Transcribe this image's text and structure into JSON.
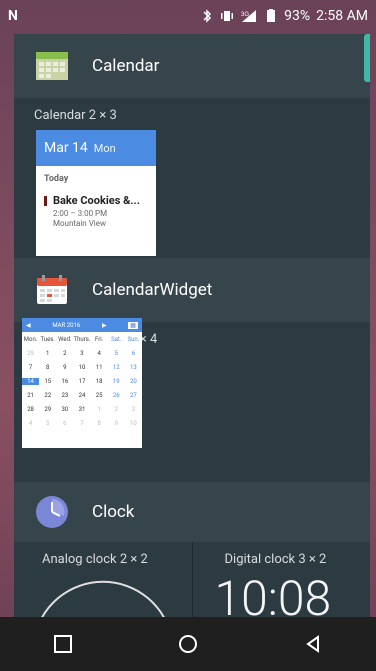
{
  "statusbar": {
    "battery": "93%",
    "time": "2:58 AM",
    "network": "3G"
  },
  "sections": [
    {
      "app_name": "Calendar",
      "widget_label": "Calendar  2 × 3"
    },
    {
      "app_name": "CalendarWidget",
      "widget_label": "CalendarWidget  4 × 4"
    },
    {
      "app_name": "Clock"
    }
  ],
  "calendar_preview": {
    "date": "Mar 14",
    "weekday": "Mon",
    "today_label": "Today",
    "event_title": "Bake Cookies &...",
    "event_time": "2:00 – 3:00 PM",
    "event_location": "Mountain View"
  },
  "month_preview": {
    "title": "MAR 2016",
    "weekdays": [
      "Mon.",
      "Tues.",
      "Wed.",
      "Thurs.",
      "Fri.",
      "Sat.",
      "Sun."
    ],
    "rows": [
      [
        "29",
        "1",
        "2",
        "3",
        "4",
        "5",
        "6"
      ],
      [
        "7",
        "8",
        "9",
        "10",
        "11",
        "12",
        "13"
      ],
      [
        "14",
        "15",
        "16",
        "17",
        "18",
        "19",
        "20"
      ],
      [
        "21",
        "22",
        "23",
        "24",
        "25",
        "26",
        "27"
      ],
      [
        "28",
        "29",
        "30",
        "31",
        "1",
        "2",
        "3"
      ],
      [
        "4",
        "5",
        "6",
        "7",
        "8",
        "9",
        "10"
      ]
    ]
  },
  "clock_widgets": {
    "analog_label": "Analog clock  2 × 2",
    "digital_label": "Digital clock  3 × 2",
    "digital_time": "10:08"
  }
}
